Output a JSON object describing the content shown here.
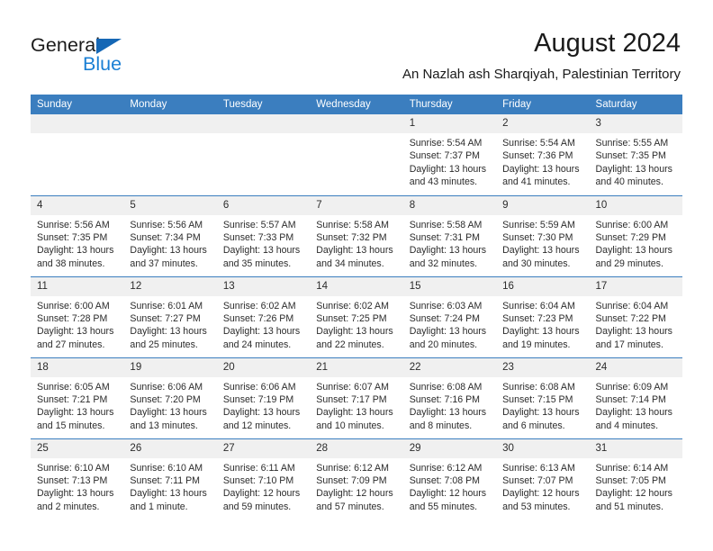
{
  "brand": {
    "name_part1": "General",
    "name_part2": "Blue",
    "triangle_color": "#1567b5",
    "blue_color": "#1a7fd4"
  },
  "header": {
    "title": "August 2024",
    "subtitle": "An Nazlah ash Sharqiyah, Palestinian Territory",
    "accent_color": "#3b7ebf",
    "daynum_bg": "#f0f0f0"
  },
  "calendar": {
    "weekday_headers": [
      "Sunday",
      "Monday",
      "Tuesday",
      "Wednesday",
      "Thursday",
      "Friday",
      "Saturday"
    ],
    "weeks": [
      [
        {
          "day": "",
          "sunrise": "",
          "sunset": "",
          "daylight1": "",
          "daylight2": "",
          "empty": true
        },
        {
          "day": "",
          "sunrise": "",
          "sunset": "",
          "daylight1": "",
          "daylight2": "",
          "empty": true
        },
        {
          "day": "",
          "sunrise": "",
          "sunset": "",
          "daylight1": "",
          "daylight2": "",
          "empty": true
        },
        {
          "day": "",
          "sunrise": "",
          "sunset": "",
          "daylight1": "",
          "daylight2": "",
          "empty": true
        },
        {
          "day": "1",
          "sunrise": "Sunrise: 5:54 AM",
          "sunset": "Sunset: 7:37 PM",
          "daylight1": "Daylight: 13 hours",
          "daylight2": "and 43 minutes.",
          "empty": false
        },
        {
          "day": "2",
          "sunrise": "Sunrise: 5:54 AM",
          "sunset": "Sunset: 7:36 PM",
          "daylight1": "Daylight: 13 hours",
          "daylight2": "and 41 minutes.",
          "empty": false
        },
        {
          "day": "3",
          "sunrise": "Sunrise: 5:55 AM",
          "sunset": "Sunset: 7:35 PM",
          "daylight1": "Daylight: 13 hours",
          "daylight2": "and 40 minutes.",
          "empty": false
        }
      ],
      [
        {
          "day": "4",
          "sunrise": "Sunrise: 5:56 AM",
          "sunset": "Sunset: 7:35 PM",
          "daylight1": "Daylight: 13 hours",
          "daylight2": "and 38 minutes.",
          "empty": false
        },
        {
          "day": "5",
          "sunrise": "Sunrise: 5:56 AM",
          "sunset": "Sunset: 7:34 PM",
          "daylight1": "Daylight: 13 hours",
          "daylight2": "and 37 minutes.",
          "empty": false
        },
        {
          "day": "6",
          "sunrise": "Sunrise: 5:57 AM",
          "sunset": "Sunset: 7:33 PM",
          "daylight1": "Daylight: 13 hours",
          "daylight2": "and 35 minutes.",
          "empty": false
        },
        {
          "day": "7",
          "sunrise": "Sunrise: 5:58 AM",
          "sunset": "Sunset: 7:32 PM",
          "daylight1": "Daylight: 13 hours",
          "daylight2": "and 34 minutes.",
          "empty": false
        },
        {
          "day": "8",
          "sunrise": "Sunrise: 5:58 AM",
          "sunset": "Sunset: 7:31 PM",
          "daylight1": "Daylight: 13 hours",
          "daylight2": "and 32 minutes.",
          "empty": false
        },
        {
          "day": "9",
          "sunrise": "Sunrise: 5:59 AM",
          "sunset": "Sunset: 7:30 PM",
          "daylight1": "Daylight: 13 hours",
          "daylight2": "and 30 minutes.",
          "empty": false
        },
        {
          "day": "10",
          "sunrise": "Sunrise: 6:00 AM",
          "sunset": "Sunset: 7:29 PM",
          "daylight1": "Daylight: 13 hours",
          "daylight2": "and 29 minutes.",
          "empty": false
        }
      ],
      [
        {
          "day": "11",
          "sunrise": "Sunrise: 6:00 AM",
          "sunset": "Sunset: 7:28 PM",
          "daylight1": "Daylight: 13 hours",
          "daylight2": "and 27 minutes.",
          "empty": false
        },
        {
          "day": "12",
          "sunrise": "Sunrise: 6:01 AM",
          "sunset": "Sunset: 7:27 PM",
          "daylight1": "Daylight: 13 hours",
          "daylight2": "and 25 minutes.",
          "empty": false
        },
        {
          "day": "13",
          "sunrise": "Sunrise: 6:02 AM",
          "sunset": "Sunset: 7:26 PM",
          "daylight1": "Daylight: 13 hours",
          "daylight2": "and 24 minutes.",
          "empty": false
        },
        {
          "day": "14",
          "sunrise": "Sunrise: 6:02 AM",
          "sunset": "Sunset: 7:25 PM",
          "daylight1": "Daylight: 13 hours",
          "daylight2": "and 22 minutes.",
          "empty": false
        },
        {
          "day": "15",
          "sunrise": "Sunrise: 6:03 AM",
          "sunset": "Sunset: 7:24 PM",
          "daylight1": "Daylight: 13 hours",
          "daylight2": "and 20 minutes.",
          "empty": false
        },
        {
          "day": "16",
          "sunrise": "Sunrise: 6:04 AM",
          "sunset": "Sunset: 7:23 PM",
          "daylight1": "Daylight: 13 hours",
          "daylight2": "and 19 minutes.",
          "empty": false
        },
        {
          "day": "17",
          "sunrise": "Sunrise: 6:04 AM",
          "sunset": "Sunset: 7:22 PM",
          "daylight1": "Daylight: 13 hours",
          "daylight2": "and 17 minutes.",
          "empty": false
        }
      ],
      [
        {
          "day": "18",
          "sunrise": "Sunrise: 6:05 AM",
          "sunset": "Sunset: 7:21 PM",
          "daylight1": "Daylight: 13 hours",
          "daylight2": "and 15 minutes.",
          "empty": false
        },
        {
          "day": "19",
          "sunrise": "Sunrise: 6:06 AM",
          "sunset": "Sunset: 7:20 PM",
          "daylight1": "Daylight: 13 hours",
          "daylight2": "and 13 minutes.",
          "empty": false
        },
        {
          "day": "20",
          "sunrise": "Sunrise: 6:06 AM",
          "sunset": "Sunset: 7:19 PM",
          "daylight1": "Daylight: 13 hours",
          "daylight2": "and 12 minutes.",
          "empty": false
        },
        {
          "day": "21",
          "sunrise": "Sunrise: 6:07 AM",
          "sunset": "Sunset: 7:17 PM",
          "daylight1": "Daylight: 13 hours",
          "daylight2": "and 10 minutes.",
          "empty": false
        },
        {
          "day": "22",
          "sunrise": "Sunrise: 6:08 AM",
          "sunset": "Sunset: 7:16 PM",
          "daylight1": "Daylight: 13 hours",
          "daylight2": "and 8 minutes.",
          "empty": false
        },
        {
          "day": "23",
          "sunrise": "Sunrise: 6:08 AM",
          "sunset": "Sunset: 7:15 PM",
          "daylight1": "Daylight: 13 hours",
          "daylight2": "and 6 minutes.",
          "empty": false
        },
        {
          "day": "24",
          "sunrise": "Sunrise: 6:09 AM",
          "sunset": "Sunset: 7:14 PM",
          "daylight1": "Daylight: 13 hours",
          "daylight2": "and 4 minutes.",
          "empty": false
        }
      ],
      [
        {
          "day": "25",
          "sunrise": "Sunrise: 6:10 AM",
          "sunset": "Sunset: 7:13 PM",
          "daylight1": "Daylight: 13 hours",
          "daylight2": "and 2 minutes.",
          "empty": false
        },
        {
          "day": "26",
          "sunrise": "Sunrise: 6:10 AM",
          "sunset": "Sunset: 7:11 PM",
          "daylight1": "Daylight: 13 hours",
          "daylight2": "and 1 minute.",
          "empty": false
        },
        {
          "day": "27",
          "sunrise": "Sunrise: 6:11 AM",
          "sunset": "Sunset: 7:10 PM",
          "daylight1": "Daylight: 12 hours",
          "daylight2": "and 59 minutes.",
          "empty": false
        },
        {
          "day": "28",
          "sunrise": "Sunrise: 6:12 AM",
          "sunset": "Sunset: 7:09 PM",
          "daylight1": "Daylight: 12 hours",
          "daylight2": "and 57 minutes.",
          "empty": false
        },
        {
          "day": "29",
          "sunrise": "Sunrise: 6:12 AM",
          "sunset": "Sunset: 7:08 PM",
          "daylight1": "Daylight: 12 hours",
          "daylight2": "and 55 minutes.",
          "empty": false
        },
        {
          "day": "30",
          "sunrise": "Sunrise: 6:13 AM",
          "sunset": "Sunset: 7:07 PM",
          "daylight1": "Daylight: 12 hours",
          "daylight2": "and 53 minutes.",
          "empty": false
        },
        {
          "day": "31",
          "sunrise": "Sunrise: 6:14 AM",
          "sunset": "Sunset: 7:05 PM",
          "daylight1": "Daylight: 12 hours",
          "daylight2": "and 51 minutes.",
          "empty": false
        }
      ]
    ]
  }
}
